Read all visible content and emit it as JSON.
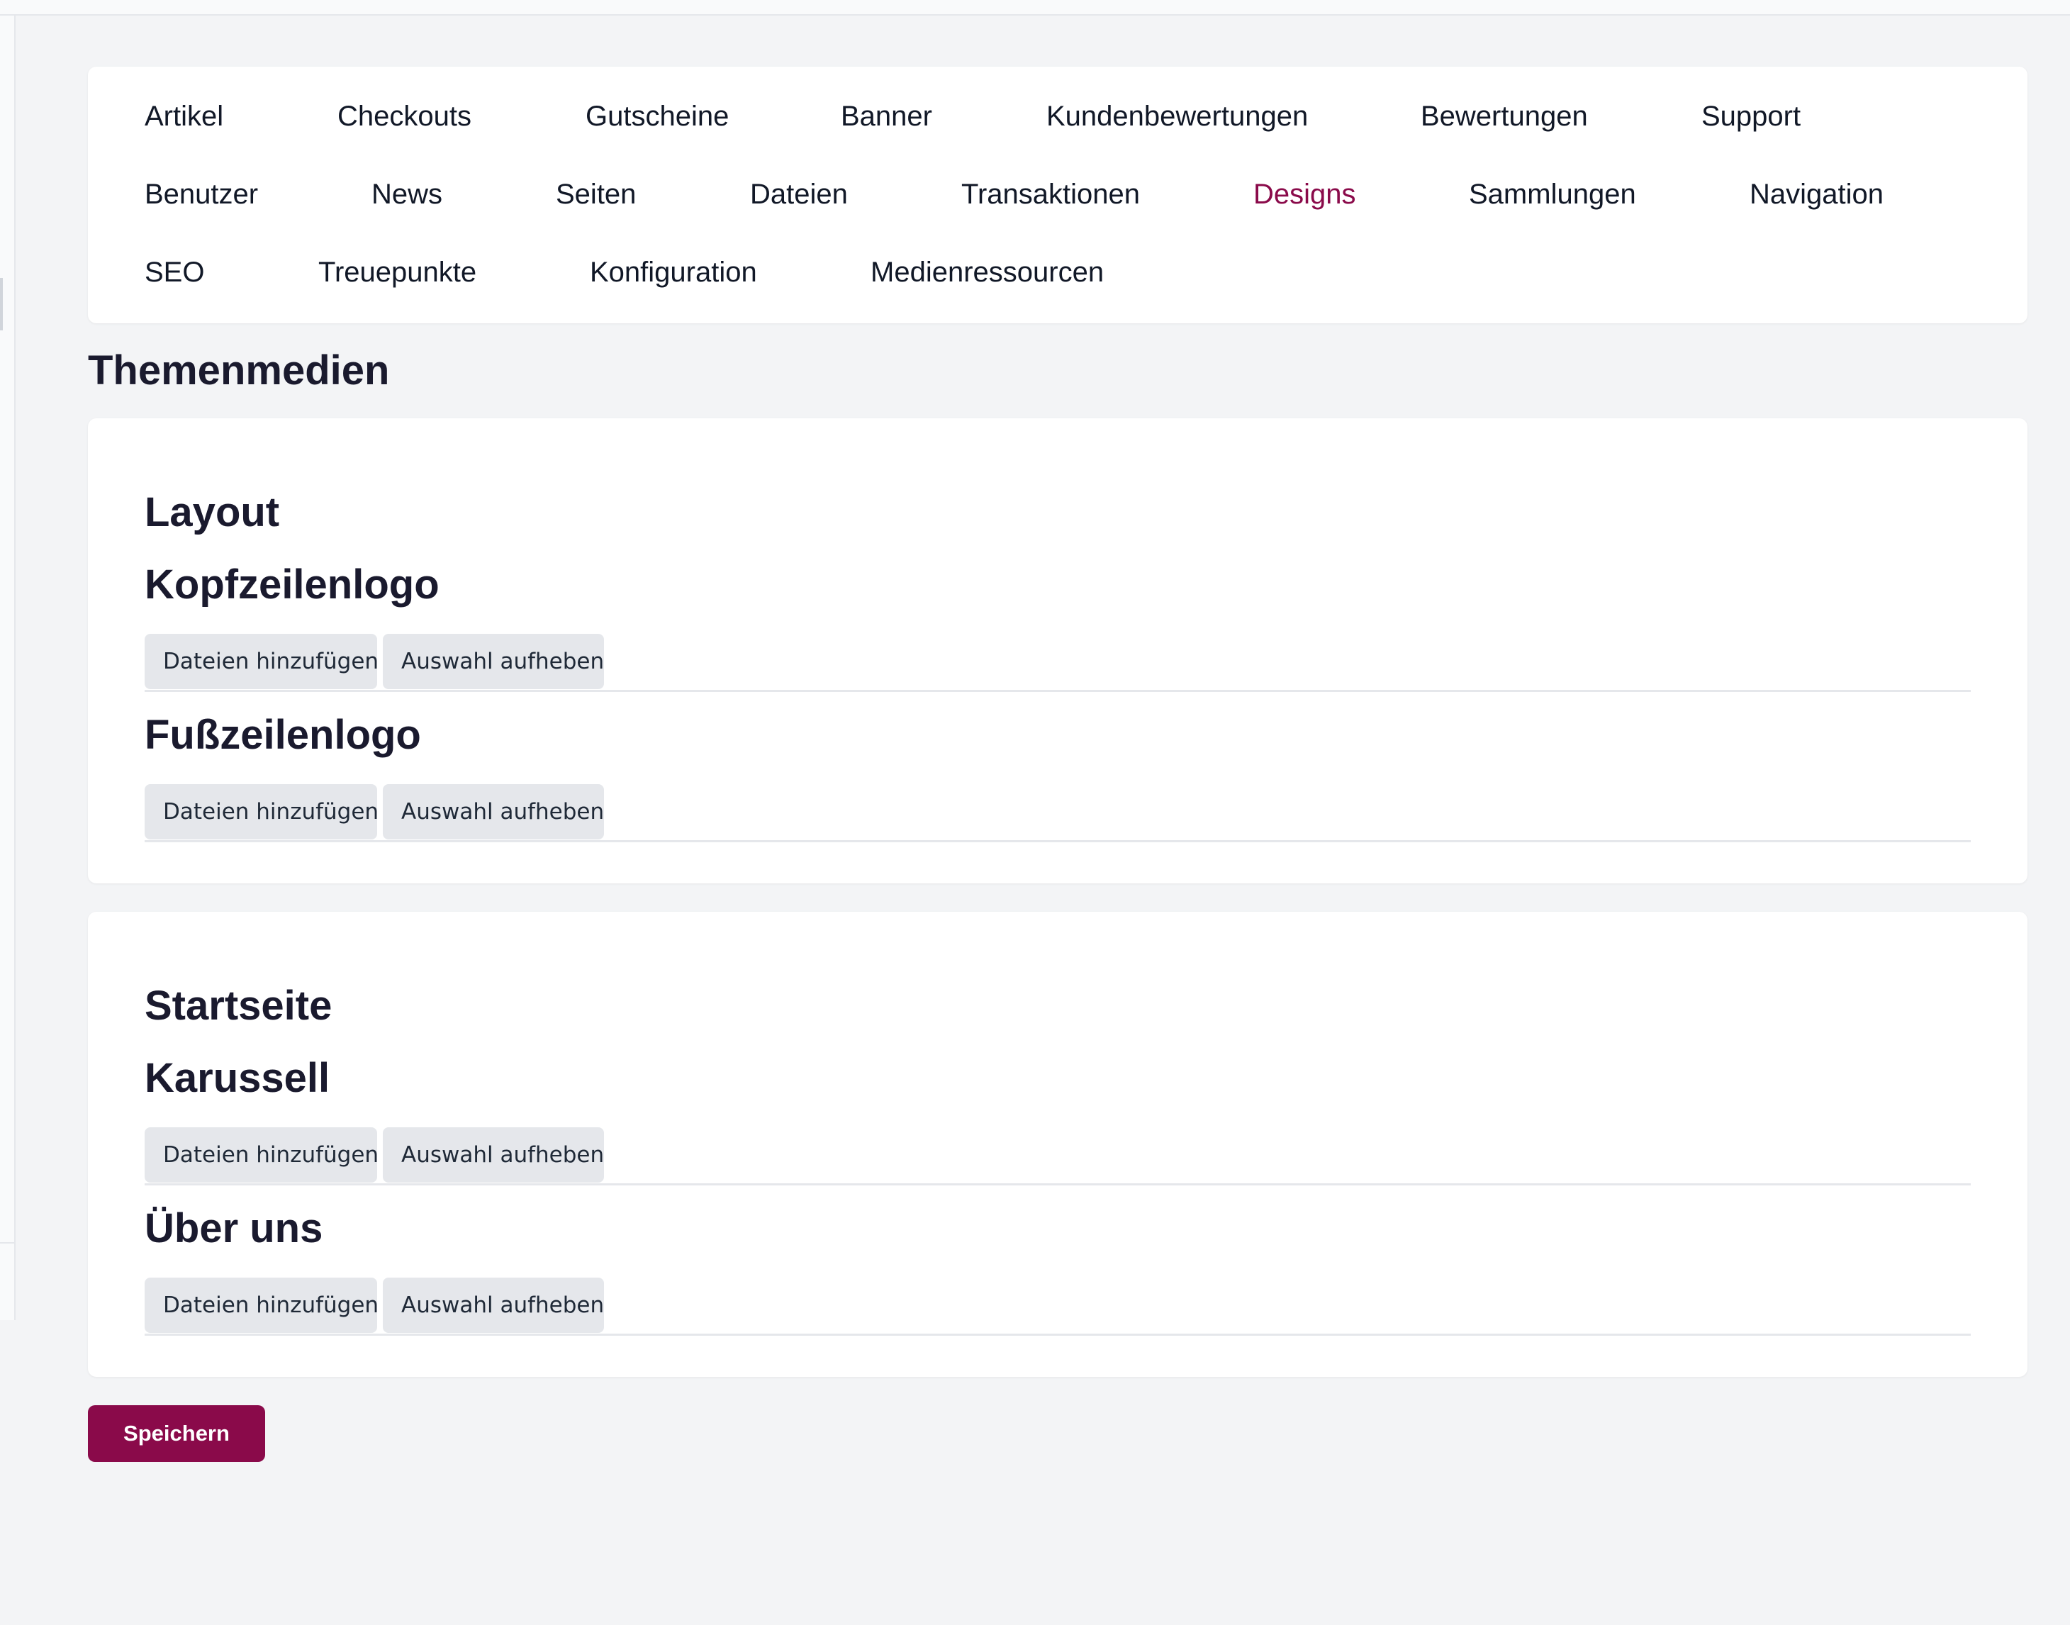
{
  "nav": {
    "items": [
      {
        "label": "Artikel",
        "active": false
      },
      {
        "label": "Checkouts",
        "active": false
      },
      {
        "label": "Gutscheine",
        "active": false
      },
      {
        "label": "Banner",
        "active": false
      },
      {
        "label": "Kundenbewertungen",
        "active": false
      },
      {
        "label": "Bewertungen",
        "active": false
      },
      {
        "label": "Support",
        "active": false
      },
      {
        "label": "Benutzer",
        "active": false
      },
      {
        "label": "News",
        "active": false
      },
      {
        "label": "Seiten",
        "active": false
      },
      {
        "label": "Dateien",
        "active": false
      },
      {
        "label": "Transaktionen",
        "active": false
      },
      {
        "label": "Designs",
        "active": true
      },
      {
        "label": "Sammlungen",
        "active": false
      },
      {
        "label": "Navigation",
        "active": false
      },
      {
        "label": "SEO",
        "active": false
      },
      {
        "label": "Treuepunkte",
        "active": false
      },
      {
        "label": "Konfiguration",
        "active": false
      },
      {
        "label": "Medienressourcen",
        "active": false
      }
    ]
  },
  "page": {
    "title": "Themenmedien"
  },
  "sections": [
    {
      "title": "Layout",
      "fields": [
        {
          "label": "Kopfzeilenlogo",
          "add_label": "Dateien hinzufügen",
          "clear_label": "Auswahl aufheben"
        },
        {
          "label": "Fußzeilenlogo",
          "add_label": "Dateien hinzufügen",
          "clear_label": "Auswahl aufheben"
        }
      ]
    },
    {
      "title": "Startseite",
      "fields": [
        {
          "label": "Karussell",
          "add_label": "Dateien hinzufügen",
          "clear_label": "Auswahl aufheben"
        },
        {
          "label": "Über uns",
          "add_label": "Dateien hinzufügen",
          "clear_label": "Auswahl aufheben"
        }
      ]
    }
  ],
  "actions": {
    "save_label": "Speichern"
  },
  "colors": {
    "accent": "#8a0a4a",
    "background": "#f3f4f6",
    "card": "#ffffff",
    "button_gray": "#e5e7eb"
  }
}
